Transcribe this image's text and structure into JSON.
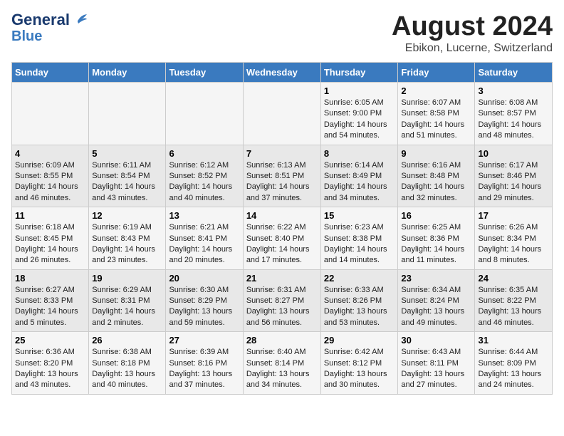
{
  "header": {
    "logo_line1": "General",
    "logo_line2": "Blue",
    "title": "August 2024",
    "subtitle": "Ebikon, Lucerne, Switzerland"
  },
  "weekdays": [
    "Sunday",
    "Monday",
    "Tuesday",
    "Wednesday",
    "Thursday",
    "Friday",
    "Saturday"
  ],
  "weeks": [
    [
      {
        "day": "",
        "content": ""
      },
      {
        "day": "",
        "content": ""
      },
      {
        "day": "",
        "content": ""
      },
      {
        "day": "",
        "content": ""
      },
      {
        "day": "1",
        "content": "Sunrise: 6:05 AM\nSunset: 9:00 PM\nDaylight: 14 hours\nand 54 minutes."
      },
      {
        "day": "2",
        "content": "Sunrise: 6:07 AM\nSunset: 8:58 PM\nDaylight: 14 hours\nand 51 minutes."
      },
      {
        "day": "3",
        "content": "Sunrise: 6:08 AM\nSunset: 8:57 PM\nDaylight: 14 hours\nand 48 minutes."
      }
    ],
    [
      {
        "day": "4",
        "content": "Sunrise: 6:09 AM\nSunset: 8:55 PM\nDaylight: 14 hours\nand 46 minutes."
      },
      {
        "day": "5",
        "content": "Sunrise: 6:11 AM\nSunset: 8:54 PM\nDaylight: 14 hours\nand 43 minutes."
      },
      {
        "day": "6",
        "content": "Sunrise: 6:12 AM\nSunset: 8:52 PM\nDaylight: 14 hours\nand 40 minutes."
      },
      {
        "day": "7",
        "content": "Sunrise: 6:13 AM\nSunset: 8:51 PM\nDaylight: 14 hours\nand 37 minutes."
      },
      {
        "day": "8",
        "content": "Sunrise: 6:14 AM\nSunset: 8:49 PM\nDaylight: 14 hours\nand 34 minutes."
      },
      {
        "day": "9",
        "content": "Sunrise: 6:16 AM\nSunset: 8:48 PM\nDaylight: 14 hours\nand 32 minutes."
      },
      {
        "day": "10",
        "content": "Sunrise: 6:17 AM\nSunset: 8:46 PM\nDaylight: 14 hours\nand 29 minutes."
      }
    ],
    [
      {
        "day": "11",
        "content": "Sunrise: 6:18 AM\nSunset: 8:45 PM\nDaylight: 14 hours\nand 26 minutes."
      },
      {
        "day": "12",
        "content": "Sunrise: 6:19 AM\nSunset: 8:43 PM\nDaylight: 14 hours\nand 23 minutes."
      },
      {
        "day": "13",
        "content": "Sunrise: 6:21 AM\nSunset: 8:41 PM\nDaylight: 14 hours\nand 20 minutes."
      },
      {
        "day": "14",
        "content": "Sunrise: 6:22 AM\nSunset: 8:40 PM\nDaylight: 14 hours\nand 17 minutes."
      },
      {
        "day": "15",
        "content": "Sunrise: 6:23 AM\nSunset: 8:38 PM\nDaylight: 14 hours\nand 14 minutes."
      },
      {
        "day": "16",
        "content": "Sunrise: 6:25 AM\nSunset: 8:36 PM\nDaylight: 14 hours\nand 11 minutes."
      },
      {
        "day": "17",
        "content": "Sunrise: 6:26 AM\nSunset: 8:34 PM\nDaylight: 14 hours\nand 8 minutes."
      }
    ],
    [
      {
        "day": "18",
        "content": "Sunrise: 6:27 AM\nSunset: 8:33 PM\nDaylight: 14 hours\nand 5 minutes."
      },
      {
        "day": "19",
        "content": "Sunrise: 6:29 AM\nSunset: 8:31 PM\nDaylight: 14 hours\nand 2 minutes."
      },
      {
        "day": "20",
        "content": "Sunrise: 6:30 AM\nSunset: 8:29 PM\nDaylight: 13 hours\nand 59 minutes."
      },
      {
        "day": "21",
        "content": "Sunrise: 6:31 AM\nSunset: 8:27 PM\nDaylight: 13 hours\nand 56 minutes."
      },
      {
        "day": "22",
        "content": "Sunrise: 6:33 AM\nSunset: 8:26 PM\nDaylight: 13 hours\nand 53 minutes."
      },
      {
        "day": "23",
        "content": "Sunrise: 6:34 AM\nSunset: 8:24 PM\nDaylight: 13 hours\nand 49 minutes."
      },
      {
        "day": "24",
        "content": "Sunrise: 6:35 AM\nSunset: 8:22 PM\nDaylight: 13 hours\nand 46 minutes."
      }
    ],
    [
      {
        "day": "25",
        "content": "Sunrise: 6:36 AM\nSunset: 8:20 PM\nDaylight: 13 hours\nand 43 minutes."
      },
      {
        "day": "26",
        "content": "Sunrise: 6:38 AM\nSunset: 8:18 PM\nDaylight: 13 hours\nand 40 minutes."
      },
      {
        "day": "27",
        "content": "Sunrise: 6:39 AM\nSunset: 8:16 PM\nDaylight: 13 hours\nand 37 minutes."
      },
      {
        "day": "28",
        "content": "Sunrise: 6:40 AM\nSunset: 8:14 PM\nDaylight: 13 hours\nand 34 minutes."
      },
      {
        "day": "29",
        "content": "Sunrise: 6:42 AM\nSunset: 8:12 PM\nDaylight: 13 hours\nand 30 minutes."
      },
      {
        "day": "30",
        "content": "Sunrise: 6:43 AM\nSunset: 8:11 PM\nDaylight: 13 hours\nand 27 minutes."
      },
      {
        "day": "31",
        "content": "Sunrise: 6:44 AM\nSunset: 8:09 PM\nDaylight: 13 hours\nand 24 minutes."
      }
    ]
  ]
}
